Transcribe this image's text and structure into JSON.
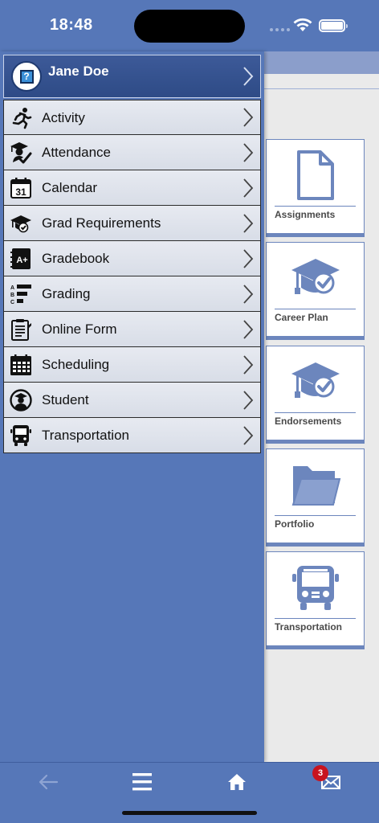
{
  "status_bar": {
    "time": "18:48"
  },
  "user": {
    "name": "Jane Doe",
    "avatar_icon": "question-badge-icon"
  },
  "menu": [
    {
      "label": "Activity",
      "icon": "runner-icon"
    },
    {
      "label": "Attendance",
      "icon": "graduate-check-icon"
    },
    {
      "label": "Calendar",
      "icon": "calendar-icon",
      "icon_text": "31"
    },
    {
      "label": "Grad Requirements",
      "icon": "grad-cap-icon"
    },
    {
      "label": "Gradebook",
      "icon": "gradebook-icon",
      "icon_text": "A+"
    },
    {
      "label": "Grading",
      "icon": "grading-list-icon"
    },
    {
      "label": "Online Form",
      "icon": "clipboard-icon"
    },
    {
      "label": "Scheduling",
      "icon": "schedule-grid-icon"
    },
    {
      "label": "Student",
      "icon": "student-icon"
    },
    {
      "label": "Transportation",
      "icon": "bus-icon"
    }
  ],
  "tiles": [
    {
      "label": "Assignments",
      "icon": "document-icon"
    },
    {
      "label": "Career Plan",
      "icon": "grad-cap-check-icon"
    },
    {
      "label": "Endorsements",
      "icon": "grad-cap-check-icon"
    },
    {
      "label": "Portfolio",
      "icon": "folder-icon"
    },
    {
      "label": "Transportation",
      "icon": "bus-icon"
    }
  ],
  "tabbar": {
    "badge_count": "3"
  },
  "colors": {
    "primary": "#5677b8",
    "header": "#2e4b86",
    "tile_accent": "#6c86bd",
    "badge": "#c8141f"
  }
}
